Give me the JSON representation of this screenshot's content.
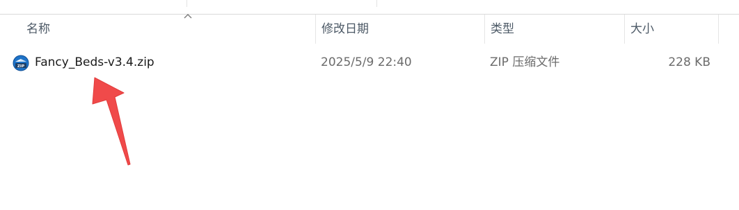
{
  "columns": {
    "name": "名称",
    "modified": "修改日期",
    "type": "类型",
    "size": "大小"
  },
  "files": [
    {
      "icon": "zip-archive-icon",
      "name": "Fancy_Beds-v3.4.zip",
      "modified": "2025/5/9 22:40",
      "type": "ZIP 压缩文件",
      "size": "228 KB"
    }
  ],
  "sort": {
    "column": "name",
    "direction": "ascending"
  },
  "colors": {
    "header_text": "#4c5966",
    "file_name_text": "#1a1a1a",
    "meta_text": "#6b6b6b",
    "annotation_arrow": "#f04a4a",
    "zip_icon_blue": "#1e73c8"
  }
}
